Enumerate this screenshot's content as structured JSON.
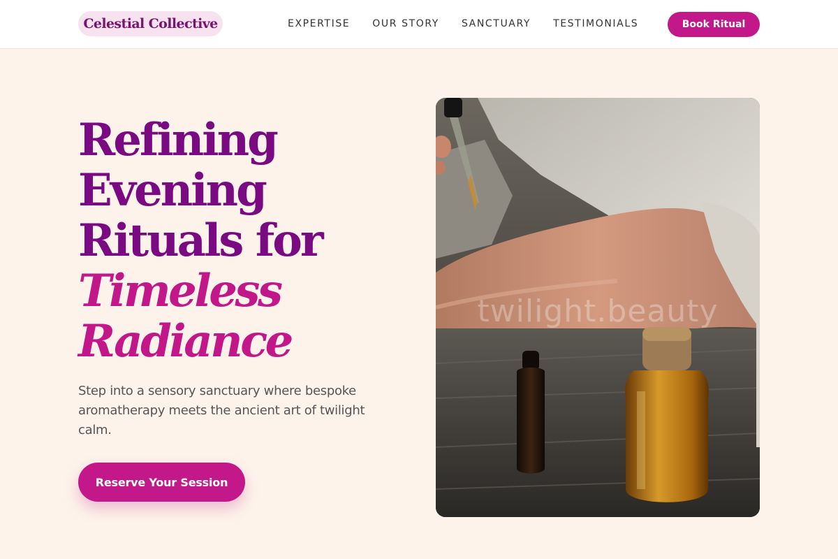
{
  "brand": {
    "name": "Celestial Collective"
  },
  "nav": {
    "items": [
      {
        "label": "EXPERTISE"
      },
      {
        "label": "OUR STORY"
      },
      {
        "label": "SANCTUARY"
      },
      {
        "label": "TESTIMONIALS"
      }
    ],
    "cta_label": "Book Ritual"
  },
  "hero": {
    "title_lines": [
      "Refining",
      "Evening",
      "Rituals for"
    ],
    "title_accent_lines": [
      "Timeless",
      "Radiance"
    ],
    "subtitle": "Step into a sensory sanctuary where bespoke aromatherapy meets the ancient art of twilight calm.",
    "cta_label": "Reserve Your Session",
    "image": {
      "description": "Hand applying oil with a dropper onto an arm, amber and dark essential oil bottles on a rustic wooden table",
      "watermark": "twilight.beauty"
    }
  },
  "colors": {
    "primary": "#c2188a",
    "heading": "#7a0a82",
    "background": "#fdf3ea"
  }
}
